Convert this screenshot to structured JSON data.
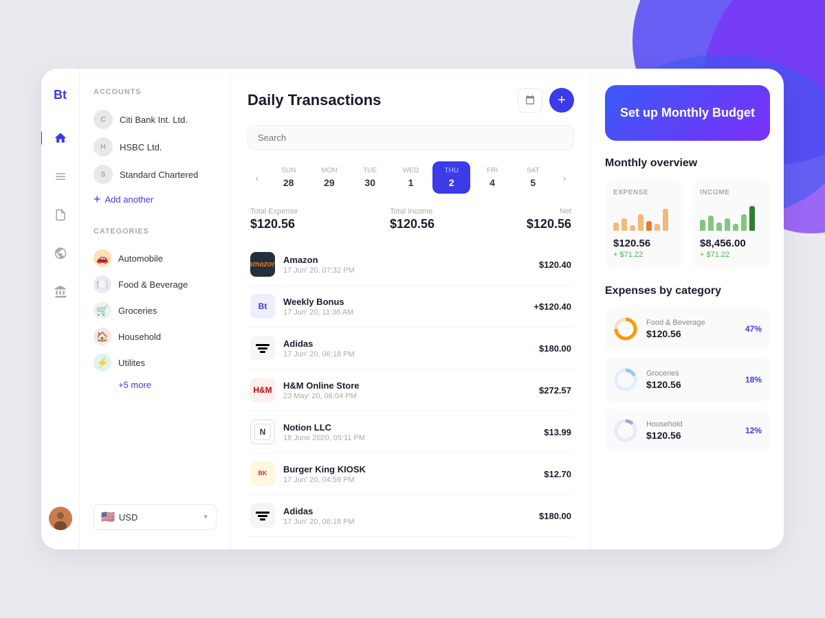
{
  "app": {
    "logo": "Bt",
    "background_accent": true
  },
  "nav_icons": [
    {
      "name": "home-icon",
      "label": "Home",
      "active": true
    },
    {
      "name": "layers-icon",
      "label": "Accounts",
      "active": false
    },
    {
      "name": "file-icon",
      "label": "Documents",
      "active": false
    },
    {
      "name": "globe-icon",
      "label": "Analytics",
      "active": false
    },
    {
      "name": "bank-icon",
      "label": "Bank",
      "active": false
    }
  ],
  "sidebar": {
    "accounts_label": "ACCOUNTS",
    "accounts": [
      {
        "name": "Citi Bank Int. Ltd.",
        "id": "citi"
      },
      {
        "name": "HSBC Ltd.",
        "id": "hsbc"
      },
      {
        "name": "Standard Chartered",
        "id": "sc"
      }
    ],
    "add_another_label": "Add another",
    "categories_label": "CATEGORIES",
    "categories": [
      {
        "name": "Automobile",
        "emoji": "🚗",
        "color": "#ffe0b2"
      },
      {
        "name": "Food & Beverage",
        "emoji": "🍽️",
        "color": "#e8eaf6"
      },
      {
        "name": "Groceries",
        "emoji": "🛒",
        "color": "#e8f5e9"
      },
      {
        "name": "Household",
        "emoji": "🏠",
        "color": "#fce4ec"
      },
      {
        "name": "Utilites",
        "emoji": "⚡",
        "color": "#e0f2f1"
      }
    ],
    "more_label": "+5 more",
    "currency": {
      "flag": "🇺🇸",
      "code": "USD"
    }
  },
  "main": {
    "title": "Daily Transactions",
    "search_placeholder": "Search",
    "days": [
      {
        "label": "SUN",
        "num": "28",
        "active": false
      },
      {
        "label": "MON",
        "num": "29",
        "active": false
      },
      {
        "label": "TUE",
        "num": "30",
        "active": false
      },
      {
        "label": "WED",
        "num": "1",
        "active": false
      },
      {
        "label": "THU",
        "num": "2",
        "active": true
      },
      {
        "label": "FRI",
        "num": "4",
        "active": false
      },
      {
        "label": "SAT",
        "num": "5",
        "active": false
      }
    ],
    "summary": {
      "expense_label": "Total Expense",
      "expense_value": "$120.56",
      "income_label": "Total Income",
      "income_value": "$120.56",
      "net_label": "Net",
      "net_value": "$120.56"
    },
    "transactions": [
      {
        "id": "t1",
        "name": "Amazon",
        "date": "17 Jun' 20, 07:32 PM",
        "amount": "$120.40",
        "logo": "amazon"
      },
      {
        "id": "t2",
        "name": "Weekly Bonus",
        "date": "17 Jun' 20, 11:36 AM",
        "amount": "+$120.40",
        "logo": "bt"
      },
      {
        "id": "t3",
        "name": "Adidas",
        "date": "17 Jun' 20, 06:18 PM",
        "amount": "$180.00",
        "logo": "adidas"
      },
      {
        "id": "t4",
        "name": "H&M Online Store",
        "date": "23 May' 20, 06:04 PM",
        "amount": "$272.57",
        "logo": "hm"
      },
      {
        "id": "t5",
        "name": "Notion LLC",
        "date": "18 June 2020, 05:11 PM",
        "amount": "$13.99",
        "logo": "notion"
      },
      {
        "id": "t6",
        "name": "Burger King KIOSK",
        "date": "17 Jun' 20, 04:59 PM",
        "amount": "$12.70",
        "logo": "bk"
      },
      {
        "id": "t7",
        "name": "Adidas",
        "date": "17 Jun' 20, 06:18 PM",
        "amount": "$180.00",
        "logo": "adidas"
      }
    ]
  },
  "right": {
    "budget_cta_label": "Set up Monthly Budget",
    "overview_title": "Monthly overview",
    "expense_label": "EXPENSE",
    "income_label": "INCOME",
    "expense_value": "$120.56",
    "expense_change": "+ $71.22",
    "income_value": "$8,456.00",
    "income_change": "+ $71.22",
    "expense_bars": [
      30,
      45,
      20,
      60,
      35,
      25,
      80
    ],
    "income_bars": [
      40,
      55,
      30,
      45,
      25,
      60,
      90
    ],
    "expenses_by_category_title": "Expenses by category",
    "expense_categories": [
      {
        "name": "Food & Beverage",
        "value": "$120.56",
        "percent": "47%",
        "color": "#ff9800",
        "fill": 47
      },
      {
        "name": "Groceries",
        "value": "$120.56",
        "percent": "18%",
        "color": "#90caf9",
        "fill": 18
      },
      {
        "name": "Household",
        "value": "$120.56",
        "percent": "12%",
        "color": "#b39ddb",
        "fill": 12
      }
    ]
  }
}
